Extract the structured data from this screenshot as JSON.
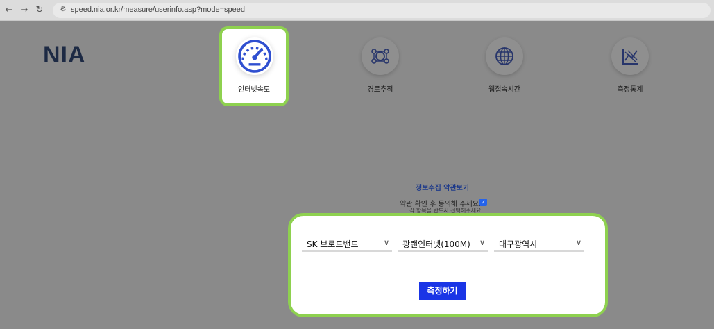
{
  "browser": {
    "url": "speed.nia.or.kr/measure/userinfo.asp?mode=speed",
    "back_icon": "arrow-left-icon",
    "forward_icon": "arrow-right-icon",
    "reload_icon": "reload-icon",
    "site_info_icon": "tune-icon"
  },
  "header": {
    "logo": "NIA"
  },
  "menu": [
    {
      "label": "인터넷속도",
      "icon": "speedometer-icon",
      "active": true
    },
    {
      "label": "경로추적",
      "icon": "route-icon",
      "active": false
    },
    {
      "label": "웹접속시간",
      "icon": "globe-icon",
      "active": false
    },
    {
      "label": "측정통계",
      "icon": "chart-icon",
      "active": false
    }
  ],
  "terms": {
    "title": "정보수집 약관보기",
    "agree_text": "약관 확인 후 동의해 주세요.",
    "agree_checked": true,
    "note": "각 항목을 반드시 선택해주세요"
  },
  "form": {
    "isp": "SK 브로드밴드",
    "service": "광랜인터넷(100M)",
    "region": "대구광역시",
    "submit_label": "측정하기"
  },
  "colors": {
    "highlight": "#8ed14f",
    "button": "#1a35e6",
    "logo": "#1d2a44"
  }
}
